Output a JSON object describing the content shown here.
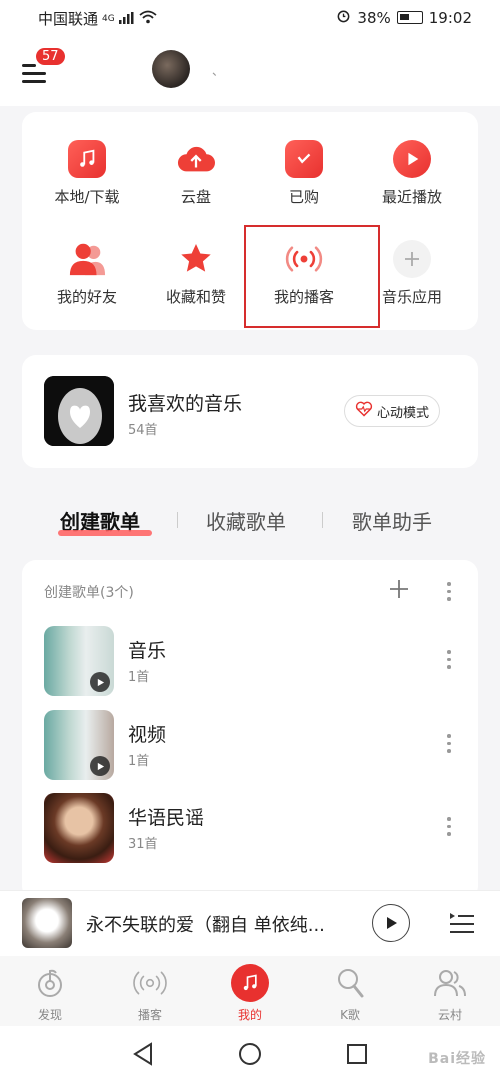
{
  "status_bar": {
    "carrier": "中国联通",
    "network": "4G",
    "battery": "38%",
    "time": "19:02"
  },
  "header": {
    "badge": "57",
    "username": "、"
  },
  "grid": {
    "items": [
      {
        "label": "本地/下载",
        "icon": "music-note-icon"
      },
      {
        "label": "云盘",
        "icon": "cloud-upload-icon"
      },
      {
        "label": "已购",
        "icon": "shopping-bag-icon"
      },
      {
        "label": "最近播放",
        "icon": "play-circle-icon"
      },
      {
        "label": "我的好友",
        "icon": "friends-icon"
      },
      {
        "label": "收藏和赞",
        "icon": "star-icon"
      },
      {
        "label": "我的播客",
        "icon": "podcast-icon"
      },
      {
        "label": "音乐应用",
        "icon": "plus-icon"
      }
    ]
  },
  "liked": {
    "title": "我喜欢的音乐",
    "count": "54首",
    "mode_button": "心动模式"
  },
  "tabs": [
    "创建歌单",
    "收藏歌单",
    "歌单助手"
  ],
  "playlists": {
    "header": "创建歌单(3个)",
    "items": [
      {
        "name": "音乐",
        "count": "1首"
      },
      {
        "name": "视频",
        "count": "1首"
      },
      {
        "name": "华语民谣",
        "count": "31首"
      }
    ]
  },
  "mini_player": {
    "title": "永不失联的爱（翻自 单依纯..."
  },
  "bottom_nav": {
    "items": [
      {
        "label": "发现"
      },
      {
        "label": "播客"
      },
      {
        "label": "我的"
      },
      {
        "label": "K歌"
      },
      {
        "label": "云村"
      }
    ]
  },
  "watermark": "Bai经验",
  "colors": {
    "accent": "#e8312f",
    "highlight_box": "#d62d2d"
  }
}
